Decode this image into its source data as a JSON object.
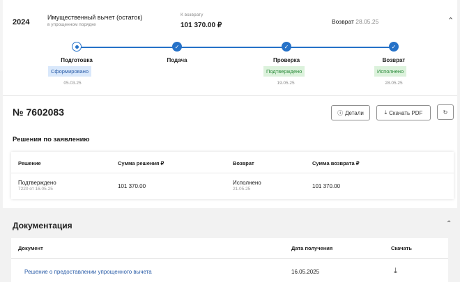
{
  "header": {
    "year": "2024",
    "title": "Имущественный вычет (остаток)",
    "subtitle": "в упрощенном порядке",
    "amount_caption": "К возврату",
    "amount": "101 370.00 ₽",
    "return_label": "Возврат",
    "return_date": "28.05.25"
  },
  "steps": [
    {
      "label": "Подготовка",
      "badge": "Сформировано",
      "badge_color": "#d9e8fb",
      "date": "05.03.25"
    },
    {
      "label": "Подача",
      "badge": "",
      "date": ""
    },
    {
      "label": "Проверка",
      "badge": "Подтверждено",
      "badge_color": "#dcf2dc",
      "date": "19.05.25"
    },
    {
      "label": "Возврат",
      "badge": "Исполнено",
      "badge_color": "#dcf2dc",
      "date": "28.05.25"
    }
  ],
  "app_number": "№ 7602083",
  "buttons": {
    "details": "Детали",
    "download_pdf": "Скачать PDF"
  },
  "decisions": {
    "title": "Решения по заявлению",
    "columns": [
      "Решение",
      "Сумма решения ₽",
      "Возврат",
      "Сумма возврата ₽"
    ],
    "row": {
      "decision": "Подтверждено",
      "decision_sub": "7220 от 16.05.25",
      "sum": "101 370.00",
      "return_status": "Исполнено",
      "return_date": "21.05.25",
      "return_sum": "101 370.00"
    }
  },
  "docs": {
    "title": "Документация",
    "columns": [
      "Документ",
      "Дата получения",
      "Скачать"
    ],
    "row": {
      "name": "Решение о предоставлении упрощенного вычета",
      "date": "16.05.2025"
    }
  },
  "accent_color": "#2672c8"
}
